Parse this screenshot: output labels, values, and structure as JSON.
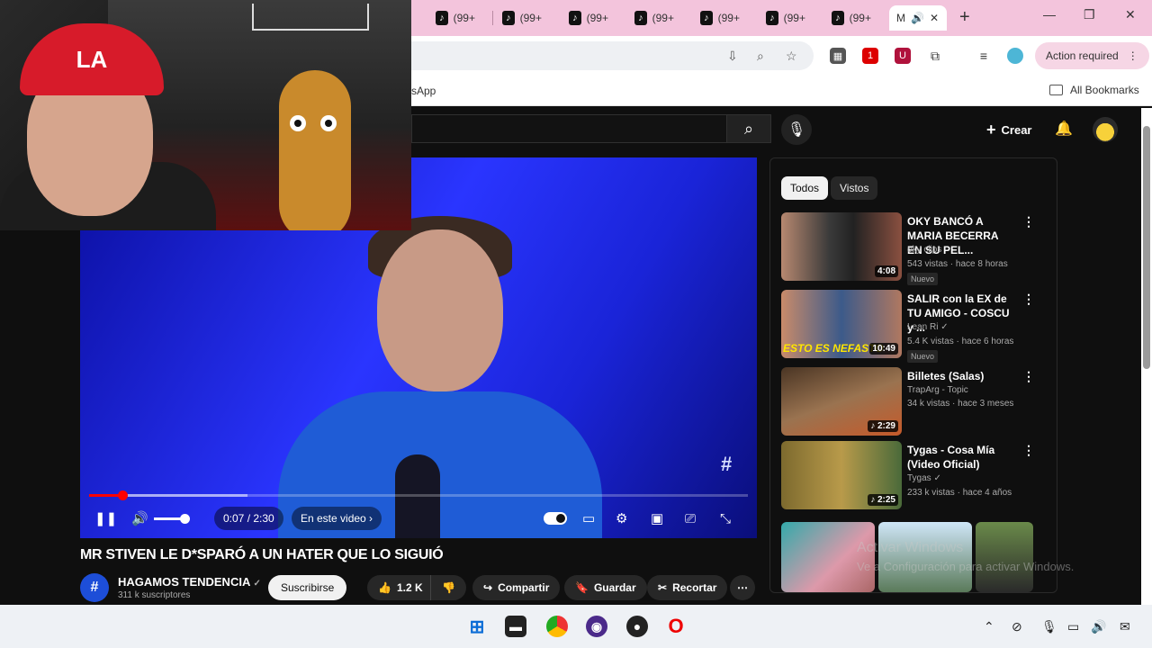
{
  "browser": {
    "tabs": [
      {
        "label": "(99+",
        "icon": "tiktok-icon"
      },
      {
        "label": "(99+",
        "icon": "tiktok-icon"
      },
      {
        "label": "(99+",
        "icon": "tiktok-icon"
      },
      {
        "label": "(99+",
        "icon": "tiktok-icon"
      },
      {
        "label": "(99+",
        "icon": "tiktok-icon"
      },
      {
        "label": "(99+",
        "icon": "tiktok-icon"
      },
      {
        "label": "(99+",
        "icon": "tiktok-icon"
      }
    ],
    "active_tab": {
      "label": "M",
      "audio_icon": "speaker-icon",
      "close": "✕"
    },
    "new_tab": "+",
    "action_required": "Action required",
    "bookmark_left": "sApp",
    "all_bookmarks": "All Bookmarks",
    "extension_badge": "1"
  },
  "youtube": {
    "create_label": "Crear",
    "video": {
      "time": "0:07 / 2:30",
      "in_this_video": "En este video",
      "progress_played": 0.05,
      "progress_loaded": 0.24,
      "title": "MR STIVEN LE D*SPARÓ A UN HATER QUE LO SIGUIÓ"
    },
    "channel": {
      "name": "HAGAMOS TENDENCIA",
      "subs": "311 k suscriptores",
      "subscribe": "Suscribirse"
    },
    "actions": {
      "likes": "1.2 K",
      "share": "Compartir",
      "save": "Guardar",
      "clip": "Recortar",
      "more": "⋯"
    },
    "chips": {
      "all": "Todos",
      "watched": "Vistos"
    },
    "recs": [
      {
        "title": "OKY BANCÓ A MARIA BECERRA EN SU PEL...",
        "channel": "oky clips",
        "meta": "543 vistas · hace 8 horas",
        "badge": "Nuevo",
        "duration": "4:08"
      },
      {
        "title": "SALIR con la EX de TU AMIGO - COSCU y ...",
        "channel": "Lean Ri ✓",
        "meta": "5.4 K vistas · hace 6 horas",
        "badge": "Nuevo",
        "duration": "10:49",
        "overlay": "ESTO ES NEFASTO"
      },
      {
        "title": "Billetes (Salas)",
        "channel": "TrapArg - Topic",
        "meta": "34 k vistas · hace 3 meses",
        "duration": "♪ 2:29"
      },
      {
        "title": "Tygas - Cosa Mía (Video Oficial)",
        "channel": "Tygas ✓",
        "meta": "233 k vistas · hace 4 años",
        "duration": "♪ 2:25"
      }
    ],
    "watermark": "Activar Windows",
    "watermark_sub": "Ve a Configuración para activar Windows."
  },
  "webcam": {
    "cap_text": "LA"
  },
  "colors": {
    "accent_red": "#ff0000",
    "tab_bar": "#f3c4dc"
  }
}
